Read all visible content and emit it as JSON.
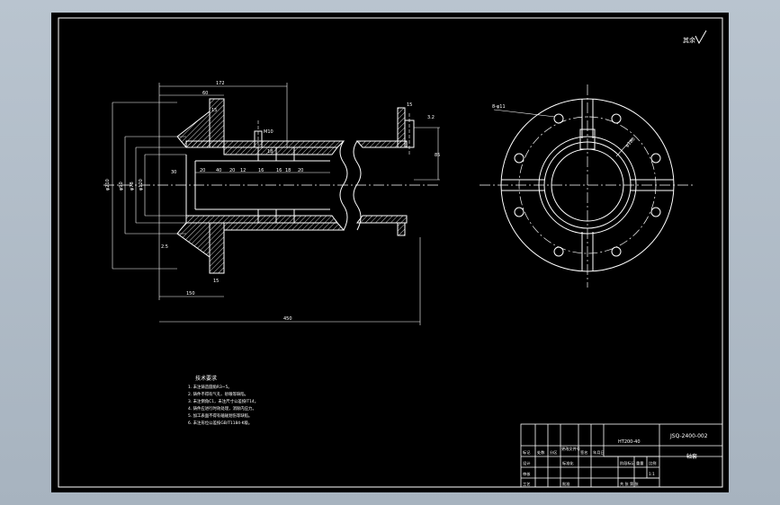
{
  "roughness_mark": "其余",
  "dims": {
    "d_top1": "172",
    "d_top2": "60",
    "d_flange_w": "15",
    "d_m10": "M10",
    "d_30a": "30",
    "d_20a": "20",
    "d_20b": "20",
    "d_20c": "20",
    "d_40a": "40",
    "d_12a": "12",
    "d_16a": "16",
    "d_16b": "16",
    "d_18a": "18",
    "d_18b": "18",
    "d_dia_a": "φ210",
    "d_dia_b": "φ90",
    "d_dia_c": "φ78",
    "d_dia_d": "φ120",
    "d_right_h": "15",
    "d_right_v": "85",
    "d_right_r": "3.2",
    "d_150": "150",
    "d_450": "450",
    "d_bot_15": "15",
    "d_bot_25": "2.5",
    "d_cross_hole": "8-φ11",
    "d_pcd": "φ180"
  },
  "notes": {
    "title": "技术要求",
    "items": [
      "1. 未注铸造圆角R3~5。",
      "2. 铸件不得有气孔、砂眼等缺陷。",
      "3. 未注倒角C1，未注尺寸公差按IT14。",
      "4. 铸件应进行时效处理，消除内应力。",
      "5. 加工表面不得有磕碰划伤等缺陷。",
      "6. 未注形位公差按GB/T1184-K级。"
    ]
  },
  "title_block": {
    "drawing_no": "JSQ-2400-002",
    "material": "HT200-40",
    "part_name": "轴套",
    "scale": "1:1",
    "col_headers": [
      "标记",
      "处数",
      "分区",
      "更改文件号",
      "签名",
      "年月日"
    ],
    "row_labels": [
      "设计",
      "审核",
      "工艺",
      "校对"
    ],
    "std": "标准化",
    "approve": "批准",
    "stage": "阶段标记",
    "weight": "重量",
    "ratio": "比例",
    "sheets": "共 张 第 张"
  }
}
